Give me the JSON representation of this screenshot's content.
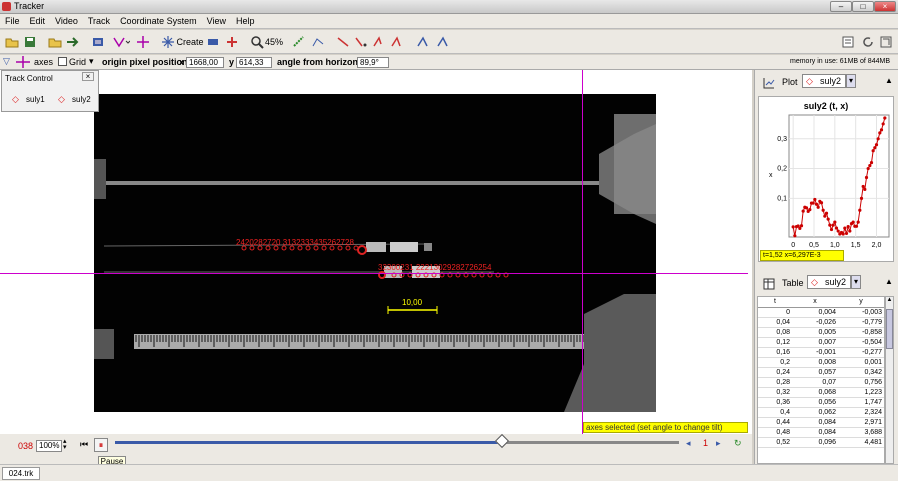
{
  "window": {
    "title": "Tracker"
  },
  "menu": [
    "File",
    "Edit",
    "Video",
    "Track",
    "Coordinate System",
    "View",
    "Help"
  ],
  "toolbar": {
    "create_label": "Create",
    "zoom": "45%"
  },
  "axes_bar": {
    "axes_label": "axes",
    "grid_label": "Grid",
    "origin_label": "origin pixel position",
    "x_label": "x",
    "x_value": "1668,00",
    "y_label": "y",
    "y_value": "614,33",
    "angle_label": "angle from horizontal",
    "angle_value": "89,9°",
    "memory": "memory in use: 61MB of 844MB"
  },
  "track_control": {
    "title": "Track Control",
    "tracks": [
      "suly1",
      "suly2"
    ]
  },
  "video": {
    "marker_labels_top": "2420282720 3132333435262728",
    "marker_labels_bottom": "32300231 22213029282726254",
    "calibration": "10,00",
    "axes_hint": "axes selected (set angle to change tilt)"
  },
  "player": {
    "frame": "038",
    "zoom": "100%",
    "tooltip": "Pause"
  },
  "status": {
    "file_tab": "024.trk"
  },
  "plot": {
    "tab_label": "Plot",
    "track": "suly2",
    "title": "suly2 (t, x)",
    "readout": "t=1,52  x=6,297E-3"
  },
  "table": {
    "tab_label": "Table",
    "track": "suly2",
    "columns": [
      "t",
      "x",
      "y"
    ],
    "rows": [
      [
        "0",
        "0,004",
        "-0,003"
      ],
      [
        "0,04",
        "-0,026",
        "-0,779"
      ],
      [
        "0,08",
        "0,005",
        "-0,858"
      ],
      [
        "0,12",
        "0,007",
        "-0,504"
      ],
      [
        "0,16",
        "-0,001",
        "-0,277"
      ],
      [
        "0,2",
        "0,008",
        "0,001"
      ],
      [
        "0,24",
        "0,057",
        "0,342"
      ],
      [
        "0,28",
        "0,07",
        "0,756"
      ],
      [
        "0,32",
        "0,068",
        "1,223"
      ],
      [
        "0,36",
        "0,056",
        "1,747"
      ],
      [
        "0,4",
        "0,062",
        "2,324"
      ],
      [
        "0,44",
        "0,084",
        "2,971"
      ],
      [
        "0,48",
        "0,084",
        "3,688"
      ],
      [
        "0,52",
        "0,096",
        "4,481"
      ]
    ]
  },
  "chart_data": {
    "type": "scatter",
    "title": "suly2 (t, x)",
    "xlabel": "",
    "ylabel": "x",
    "x_ticks": [
      "0",
      "0,5",
      "1,0",
      "1,5",
      "2,0"
    ],
    "y_ticks": [
      "0,1",
      "0,2",
      "0,3"
    ],
    "xlim": [
      -0.1,
      2.3
    ],
    "ylim": [
      -0.03,
      0.38
    ],
    "series": [
      {
        "color": "#cc0000",
        "x": [
          0,
          0.04,
          0.08,
          0.12,
          0.16,
          0.2,
          0.24,
          0.28,
          0.32,
          0.36,
          0.4,
          0.44,
          0.48,
          0.52,
          0.56,
          0.6,
          0.64,
          0.68,
          0.72,
          0.76,
          0.8,
          0.84,
          0.88,
          0.92,
          0.96,
          1.0,
          1.04,
          1.08,
          1.12,
          1.16,
          1.2,
          1.24,
          1.28,
          1.32,
          1.36,
          1.4,
          1.44,
          1.48,
          1.52,
          1.56,
          1.6,
          1.64,
          1.68,
          1.72,
          1.76,
          1.8,
          1.84,
          1.88,
          1.92,
          1.96,
          2.0,
          2.04,
          2.08,
          2.12,
          2.16,
          2.2
        ],
        "y": [
          0.004,
          -0.026,
          0.005,
          0.007,
          -0.001,
          0.008,
          0.057,
          0.07,
          0.068,
          0.056,
          0.062,
          0.084,
          0.084,
          0.096,
          0.08,
          0.07,
          0.09,
          0.085,
          0.06,
          0.04,
          0.05,
          0.03,
          0.01,
          -0.005,
          0.01,
          0.02,
          0.0,
          -0.01,
          -0.02,
          -0.015,
          -0.02,
          0.0,
          -0.018,
          0.005,
          -0.01,
          0.015,
          0.02,
          0.006,
          0.006,
          0.02,
          0.06,
          0.1,
          0.14,
          0.13,
          0.17,
          0.2,
          0.21,
          0.22,
          0.26,
          0.27,
          0.28,
          0.3,
          0.32,
          0.33,
          0.35,
          0.37
        ]
      }
    ]
  }
}
